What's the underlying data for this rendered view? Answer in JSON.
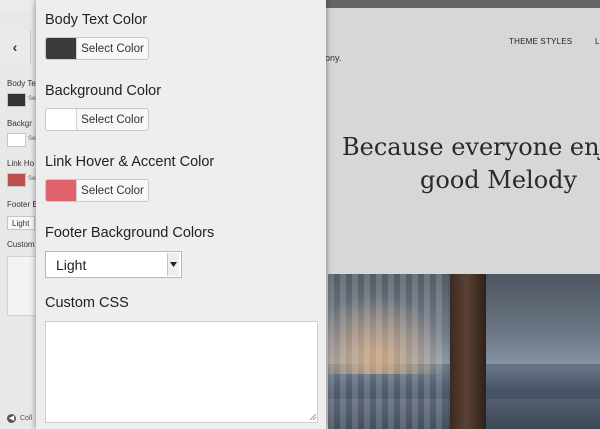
{
  "background_sidebar": {
    "labels": [
      "Body Te",
      "Backgr",
      "Link Ho",
      "Footer B",
      "Custom"
    ],
    "select_text": "Sele",
    "footer_select_value": "Light",
    "collapse_label": "Coll",
    "swatch_colors": [
      "#333333",
      "#ffffff",
      "#c0504f"
    ]
  },
  "preview": {
    "nav_theme_styles": "THEME STYLES",
    "nav_next": "L",
    "tagline_fragment": "ony.",
    "hero_line1": "Because everyone enjo",
    "hero_line2": "good Melody"
  },
  "controls": {
    "body_text_color": {
      "label": "Body Text Color",
      "button": "Select Color",
      "color": "#3a3a3a"
    },
    "background_color": {
      "label": "Background Color",
      "button": "Select Color",
      "color": "#ffffff"
    },
    "link_hover_accent_color": {
      "label": "Link Hover & Accent Color",
      "button": "Select Color",
      "color": "#e0626d"
    },
    "footer_background": {
      "label": "Footer Background Colors",
      "selected": "Light"
    },
    "custom_css": {
      "label": "Custom CSS",
      "value": ""
    }
  }
}
